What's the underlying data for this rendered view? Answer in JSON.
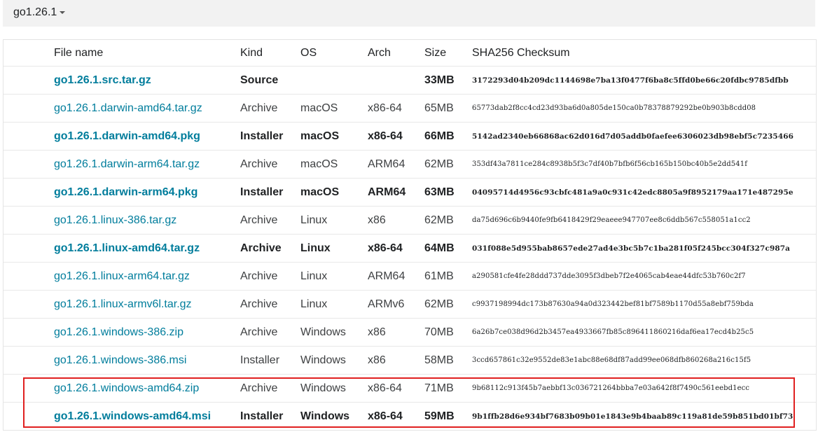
{
  "version_selector": {
    "label": "go1.26.1"
  },
  "table": {
    "headers": {
      "file": "File name",
      "kind": "Kind",
      "os": "OS",
      "arch": "Arch",
      "size": "Size",
      "sha": "SHA256 Checksum"
    },
    "rows": [
      {
        "file": "go1.26.1.src.tar.gz",
        "kind": "Source",
        "os": "",
        "arch": "",
        "size": "33MB",
        "sha": "3172293d04b209dc1144698e7ba13f0477f6ba8c5ffd0be66c20fdbc9785dfbb",
        "highlight": true
      },
      {
        "file": "go1.26.1.darwin-amd64.tar.gz",
        "kind": "Archive",
        "os": "macOS",
        "arch": "x86-64",
        "size": "65MB",
        "sha": "65773dab2f8cc4cd23d93ba6d0a805de150ca0b78378879292be0b903b8cdd08",
        "highlight": false
      },
      {
        "file": "go1.26.1.darwin-amd64.pkg",
        "kind": "Installer",
        "os": "macOS",
        "arch": "x86-64",
        "size": "66MB",
        "sha": "5142ad2340eb66868ac62d016d7d05addb0faefee6306023db98ebf5c7235466",
        "highlight": true
      },
      {
        "file": "go1.26.1.darwin-arm64.tar.gz",
        "kind": "Archive",
        "os": "macOS",
        "arch": "ARM64",
        "size": "62MB",
        "sha": "353df43a7811ce284c8938b5f3c7df40b7bfb6f56cb165b150bc40b5e2dd541f",
        "highlight": false
      },
      {
        "file": "go1.26.1.darwin-arm64.pkg",
        "kind": "Installer",
        "os": "macOS",
        "arch": "ARM64",
        "size": "63MB",
        "sha": "04095714d4956c93cbfc481a9a0c931c42edc8805a9f8952179aa171e487295e",
        "highlight": true
      },
      {
        "file": "go1.26.1.linux-386.tar.gz",
        "kind": "Archive",
        "os": "Linux",
        "arch": "x86",
        "size": "62MB",
        "sha": "da75d696c6b9440fe9fb6418429f29eaeee947707ee8c6ddb567c558051a1cc2",
        "highlight": false
      },
      {
        "file": "go1.26.1.linux-amd64.tar.gz",
        "kind": "Archive",
        "os": "Linux",
        "arch": "x86-64",
        "size": "64MB",
        "sha": "031f088e5d955bab8657ede27ad4e3bc5b7c1ba281f05f245bcc304f327c987a",
        "highlight": true
      },
      {
        "file": "go1.26.1.linux-arm64.tar.gz",
        "kind": "Archive",
        "os": "Linux",
        "arch": "ARM64",
        "size": "61MB",
        "sha": "a290581cfe4fe28ddd737dde3095f3dbeb7f2e4065cab4eae44dfc53b760c2f7",
        "highlight": false
      },
      {
        "file": "go1.26.1.linux-armv6l.tar.gz",
        "kind": "Archive",
        "os": "Linux",
        "arch": "ARMv6",
        "size": "62MB",
        "sha": "c9937198994dc173b87630a94a0d323442bef81bf7589b1170d55a8ebf759bda",
        "highlight": false
      },
      {
        "file": "go1.26.1.windows-386.zip",
        "kind": "Archive",
        "os": "Windows",
        "arch": "x86",
        "size": "70MB",
        "sha": "6a26b7ce038d96d2b3457ea4933667fb85c896411860216daf6ea17ecd4b25c5",
        "highlight": false
      },
      {
        "file": "go1.26.1.windows-386.msi",
        "kind": "Installer",
        "os": "Windows",
        "arch": "x86",
        "size": "58MB",
        "sha": "3ccd657861c32e9552de83e1abc88e68df87add99ee068dfb860268a216c15f5",
        "highlight": false
      },
      {
        "file": "go1.26.1.windows-amd64.zip",
        "kind": "Archive",
        "os": "Windows",
        "arch": "x86-64",
        "size": "71MB",
        "sha": "9b68112c913f45b7aebbf13c036721264bbba7e03a642f8f7490c561eebd1ecc",
        "highlight": false
      },
      {
        "file": "go1.26.1.windows-amd64.msi",
        "kind": "Installer",
        "os": "Windows",
        "arch": "x86-64",
        "size": "59MB",
        "sha": "9b1ffb28d6e934bf7683b09b01e1843e9b4baab89c119a81de59b851bd01bf73",
        "highlight": true
      }
    ]
  },
  "colors": {
    "link": "#007d9c",
    "annotation_box": "#e02020",
    "header_bar": "#f2f2f2"
  }
}
